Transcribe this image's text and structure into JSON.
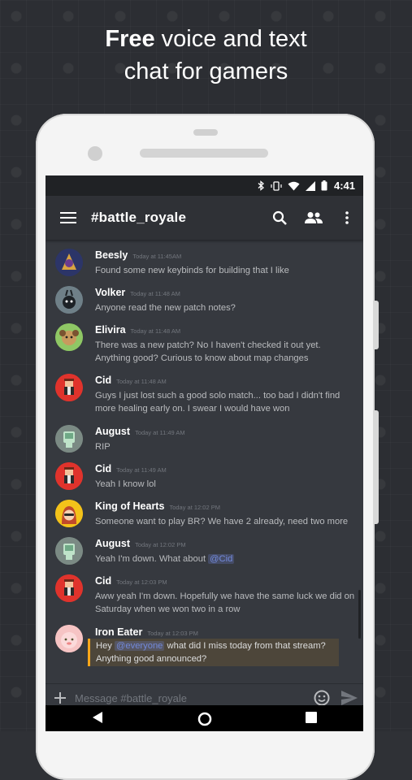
{
  "headline": {
    "bold": "Free",
    "rest": " voice and text",
    "line2": "chat for gamers"
  },
  "status": {
    "time": "4:41"
  },
  "channel": {
    "title": "#battle_royale"
  },
  "messages": [
    {
      "name": "Beesly",
      "time": "Today at 11:45AM",
      "text": "Found some new keybinds for building that I like",
      "avatar_color": "#3a4a9a"
    },
    {
      "name": "Volker",
      "time": "Today at 11:48 AM",
      "text": "Anyone read the new patch notes?",
      "avatar_color": "#5f6f7a"
    },
    {
      "name": "Elivira",
      "time": "Today at 11:48 AM",
      "text": "There was a new patch? No I haven't checked it out yet. Anything good? Curious to know about map changes",
      "avatar_color": "#7bbf5a"
    },
    {
      "name": "Cid",
      "time": "Today at 11:48 AM",
      "text": "Guys I just lost such a good solo match... too bad I didn't find more healing early on. I swear I would have won",
      "avatar_color": "#e0332c"
    },
    {
      "name": "August",
      "time": "Today at 11:49 AM",
      "text": "RIP",
      "avatar_color": "#7b8a84"
    },
    {
      "name": "Cid",
      "time": "Today at 11:49 AM",
      "text": "Yeah I know lol",
      "avatar_color": "#e0332c"
    },
    {
      "name": "King of Hearts",
      "time": "Today at 12:02 PM",
      "text": "Someone want to play BR? We have 2 already, need two more",
      "avatar_color": "#f3c21a"
    },
    {
      "name": "August",
      "time": "Today at 12:02 PM",
      "text_before": "Yeah I'm down. What about ",
      "mention": "@Cid",
      "avatar_color": "#7b8a84"
    },
    {
      "name": "Cid",
      "time": "Today at 12:03 PM",
      "text": "Aww yeah I'm down. Hopefully we have the same luck we did on Saturday when we won two in a row",
      "avatar_color": "#e0332c"
    },
    {
      "name": "Iron Eater",
      "time": "Today at 12:03 PM",
      "text_before": "Hey ",
      "mention": "@everyone",
      "text_after": " what did I miss today from that stream? Anything good announced?",
      "avatar_color": "#f4b9b9"
    }
  ],
  "composer": {
    "placeholder": "Message #battle_royale"
  },
  "colors": {
    "accent": "#7289da",
    "highlight": "#faa61a",
    "background": "#36393f"
  }
}
